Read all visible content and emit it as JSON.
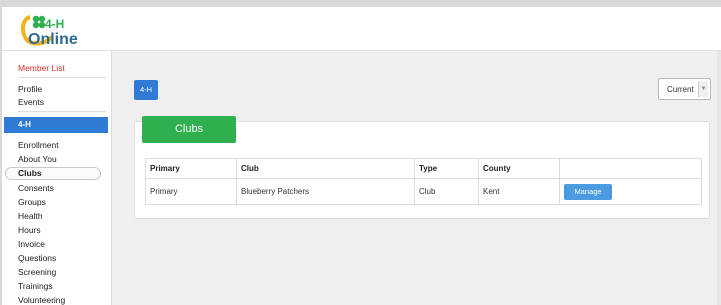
{
  "logo": {
    "mark": "4-H",
    "text": "Online",
    "tagline": ""
  },
  "sidebar": {
    "member_list": "Member List",
    "profile": "Profile",
    "events": "Events",
    "section": "4-H",
    "items": [
      "Enrollment",
      "About You",
      "Clubs",
      "Consents",
      "Groups",
      "Health",
      "Hours",
      "Invoice",
      "Questions",
      "Screening",
      "Trainings",
      "Volunteering"
    ],
    "selected": "Clubs"
  },
  "program_button": "4-H",
  "status_select": {
    "value": "Current"
  },
  "clubs_panel": {
    "title": "Clubs",
    "columns": [
      "Primary",
      "Club",
      "Type",
      "County",
      ""
    ],
    "rows": [
      {
        "primary": "Primary",
        "club": "Blueberry Patchers",
        "type": "Club",
        "county": "Kent",
        "action": "Manage"
      }
    ]
  },
  "colors": {
    "primary_blue": "#2f7bd6",
    "green": "#2eb04f",
    "red_link": "#d9302b"
  }
}
